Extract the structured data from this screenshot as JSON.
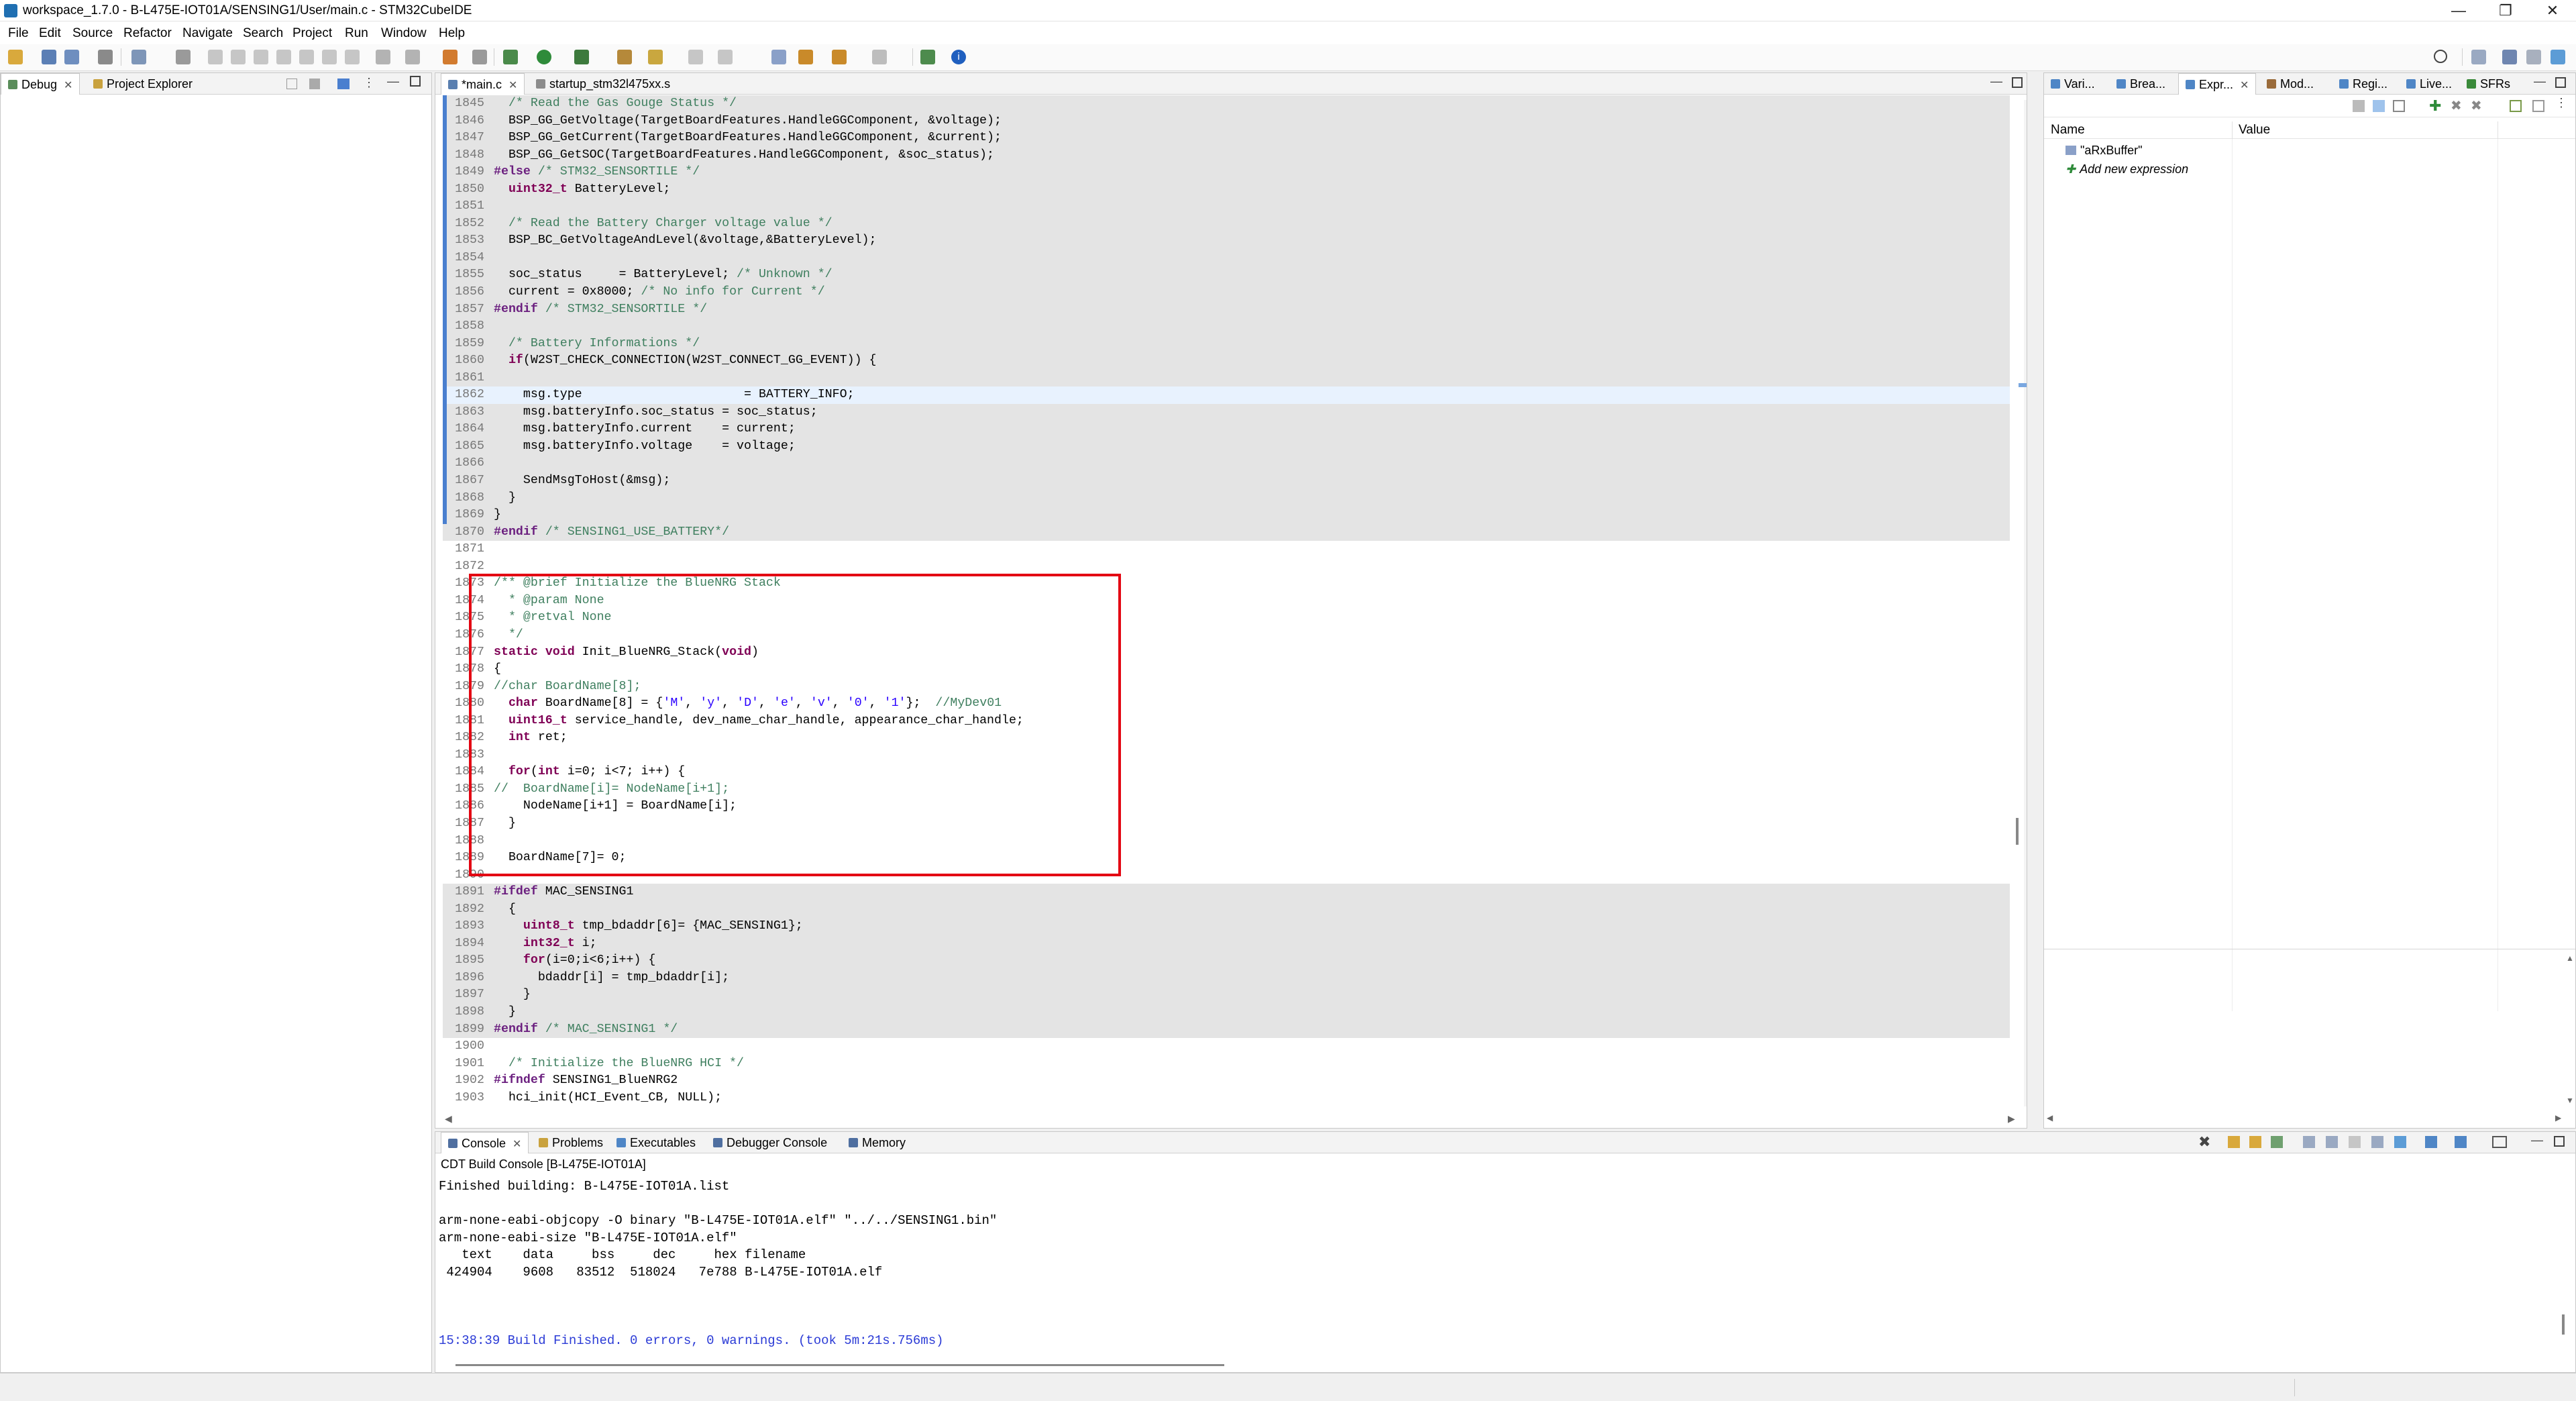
{
  "window": {
    "title": "workspace_1.7.0 - B-L475E-IOT01A/SENSING1/User/main.c - STM32CubeIDE"
  },
  "menu": [
    "File",
    "Edit",
    "Source",
    "Refactor",
    "Navigate",
    "Search",
    "Project",
    "Run",
    "Window",
    "Help"
  ],
  "left_tabs": {
    "debug": "Debug",
    "project_explorer": "Project Explorer"
  },
  "editor_tabs": [
    {
      "label": "*main.c"
    },
    {
      "label": "startup_stm32l475xx.s"
    }
  ],
  "code_lines": [
    {
      "n": "1845",
      "t": "  /* Read the Gas Gouge Status */",
      "g": true,
      "k": "cm"
    },
    {
      "n": "1846",
      "t": "  BSP_GG_GetVoltage(TargetBoardFeatures.HandleGGComponent, &voltage);",
      "g": true
    },
    {
      "n": "1847",
      "t": "  BSP_GG_GetCurrent(TargetBoardFeatures.HandleGGComponent, &current);",
      "g": true
    },
    {
      "n": "1848",
      "t": "  BSP_GG_GetSOC(TargetBoardFeatures.HandleGGComponent, &soc_status);",
      "g": true
    },
    {
      "n": "1849",
      "t": "#else /* STM32_SENSORTILE */",
      "g": true,
      "k": "mc"
    },
    {
      "n": "1850",
      "t": "  uint32_t BatteryLevel;",
      "g": true
    },
    {
      "n": "1851",
      "t": "",
      "g": true
    },
    {
      "n": "1852",
      "t": "  /* Read the Battery Charger voltage value */",
      "g": true,
      "k": "cm"
    },
    {
      "n": "1853",
      "t": "  BSP_BC_GetVoltageAndLevel(&voltage,&BatteryLevel);",
      "g": true
    },
    {
      "n": "1854",
      "t": "",
      "g": true
    },
    {
      "n": "1855",
      "t": "  soc_status     = BatteryLevel; /* Unknown */",
      "g": true
    },
    {
      "n": "1856",
      "t": "  current = 0x8000; /* No info for Current */",
      "g": true
    },
    {
      "n": "1857",
      "t": "#endif /* STM32_SENSORTILE */",
      "g": true,
      "k": "mc"
    },
    {
      "n": "1858",
      "t": "",
      "g": true
    },
    {
      "n": "1859",
      "t": "  /* Battery Informations */",
      "g": true,
      "k": "cm"
    },
    {
      "n": "1860",
      "t": "  if(W2ST_CHECK_CONNECTION(W2ST_CONNECT_GG_EVENT)) {",
      "g": true
    },
    {
      "n": "1861",
      "t": "",
      "g": true
    },
    {
      "n": "1862",
      "t": "    msg.type                      = BATTERY_INFO;",
      "g": false,
      "cur": true
    },
    {
      "n": "1863",
      "t": "    msg.batteryInfo.soc_status = soc_status;",
      "g": true
    },
    {
      "n": "1864",
      "t": "    msg.batteryInfo.current    = current;",
      "g": true
    },
    {
      "n": "1865",
      "t": "    msg.batteryInfo.voltage    = voltage;",
      "g": true
    },
    {
      "n": "1866",
      "t": "",
      "g": true
    },
    {
      "n": "1867",
      "t": "    SendMsgToHost(&msg);",
      "g": true
    },
    {
      "n": "1868",
      "t": "  }",
      "g": true
    },
    {
      "n": "1869",
      "t": "}",
      "g": true
    },
    {
      "n": "1870",
      "t": "#endif /* SENSING1_USE_BATTERY*/",
      "g": true,
      "k": "mc"
    },
    {
      "n": "1871",
      "t": "",
      "g": false
    },
    {
      "n": "1872",
      "t": "",
      "g": false
    },
    {
      "n": "1873",
      "t": "/** @brief Initialize the BlueNRG Stack",
      "g": false,
      "k": "cm"
    },
    {
      "n": "1874",
      "t": "  * @param None",
      "g": false,
      "k": "cm"
    },
    {
      "n": "1875",
      "t": "  * @retval None",
      "g": false,
      "k": "cm"
    },
    {
      "n": "1876",
      "t": "  */",
      "g": false,
      "k": "cm"
    },
    {
      "n": "1877",
      "t": "static void Init_BlueNRG_Stack(void)",
      "g": false
    },
    {
      "n": "1878",
      "t": "{",
      "g": false
    },
    {
      "n": "1879",
      "t": "//char BoardName[8];",
      "g": false,
      "k": "cm"
    },
    {
      "n": "1880",
      "t": "  char BoardName[8] = {'M', 'y', 'D', 'e', 'v', '0', '1'};  //MyDev01",
      "g": false
    },
    {
      "n": "1881",
      "t": "  uint16_t service_handle, dev_name_char_handle, appearance_char_handle;",
      "g": false
    },
    {
      "n": "1882",
      "t": "  int ret;",
      "g": false
    },
    {
      "n": "1883",
      "t": "",
      "g": false
    },
    {
      "n": "1884",
      "t": "  for(int i=0; i<7; i++) {",
      "g": false
    },
    {
      "n": "1885",
      "t": "//  BoardName[i]= NodeName[i+1];",
      "g": false,
      "k": "cm"
    },
    {
      "n": "1886",
      "t": "    NodeName[i+1] = BoardName[i];",
      "g": false
    },
    {
      "n": "1887",
      "t": "  }",
      "g": false
    },
    {
      "n": "1888",
      "t": "",
      "g": false
    },
    {
      "n": "1889",
      "t": "  BoardName[7]= 0;",
      "g": false
    },
    {
      "n": "1890",
      "t": "",
      "g": false
    },
    {
      "n": "1891",
      "t": "#ifdef MAC_SENSING1",
      "g": true,
      "k": "mc"
    },
    {
      "n": "1892",
      "t": "  {",
      "g": true
    },
    {
      "n": "1893",
      "t": "    uint8_t tmp_bdaddr[6]= {MAC_SENSING1};",
      "g": true
    },
    {
      "n": "1894",
      "t": "    int32_t i;",
      "g": true
    },
    {
      "n": "1895",
      "t": "    for(i=0;i<6;i++) {",
      "g": true
    },
    {
      "n": "1896",
      "t": "      bdaddr[i] = tmp_bdaddr[i];",
      "g": true
    },
    {
      "n": "1897",
      "t": "    }",
      "g": true
    },
    {
      "n": "1898",
      "t": "  }",
      "g": true
    },
    {
      "n": "1899",
      "t": "#endif /* MAC_SENSING1 */",
      "g": true,
      "k": "mc"
    },
    {
      "n": "1900",
      "t": "",
      "g": false
    },
    {
      "n": "1901",
      "t": "  /* Initialize the BlueNRG HCI */",
      "g": false,
      "k": "cm"
    },
    {
      "n": "1902",
      "t": "#ifndef SENSING1_BlueNRG2",
      "g": false,
      "k": "mc"
    },
    {
      "n": "1903",
      "t": "  hci_init(HCI_Event_CB, NULL);",
      "g": false
    }
  ],
  "right_tabs": [
    "Vari...",
    "Brea...",
    "Expr...",
    "Mod...",
    "Regi...",
    "Live...",
    "SFRs"
  ],
  "expressions": {
    "col_name": "Name",
    "col_value": "Value",
    "rows": [
      "\"aRxBuffer\"",
      "Add new expression"
    ]
  },
  "console_tabs": [
    "Console",
    "Problems",
    "Executables",
    "Debugger Console",
    "Memory"
  ],
  "console": {
    "header": "CDT Build Console [B-L475E-IOT01A]",
    "lines": [
      "Finished building: B-L475E-IOT01A.list",
      "",
      "arm-none-eabi-objcopy -O binary \"B-L475E-IOT01A.elf\" \"../../SENSING1.bin\"",
      "arm-none-eabi-size \"B-L475E-IOT01A.elf\"",
      "   text    data     bss     dec     hex filename",
      " 424904    9608   83512  518024   7e788 B-L475E-IOT01A.elf",
      "",
      "",
      ""
    ],
    "final": "15:38:39 Build Finished. 0 errors, 0 warnings. (took 5m:21s.756ms)"
  },
  "colors": {
    "highlight_box": "#e30613",
    "marker": "#4a7fcf",
    "build_finished": "#2b3bd6"
  }
}
